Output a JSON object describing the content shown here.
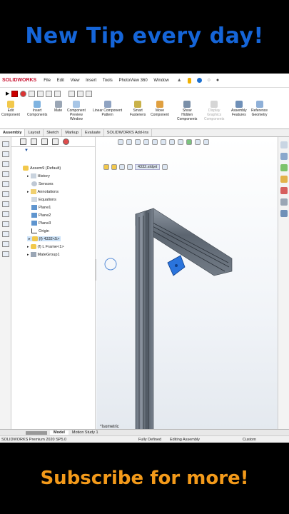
{
  "banner_top": "New Tip every day!",
  "banner_bottom": "Subscribe for more!",
  "app": {
    "logo": "SOLIDWORKS",
    "menu": [
      "File",
      "Edit",
      "View",
      "Insert",
      "Tools",
      "PhotoView 360",
      "Window"
    ],
    "commands": [
      {
        "label": "Edit\nComponent"
      },
      {
        "label": "Insert\nComponents"
      },
      {
        "label": "Mate"
      },
      {
        "label": "Component\nPreview\nWindow"
      },
      {
        "label": "Linear Component\nPattern"
      },
      {
        "label": "Smart\nFasteners"
      },
      {
        "label": "Move\nComponent"
      },
      {
        "label": "Show\nHidden\nComponents"
      },
      {
        "label": "Display\nGraphics\nComponents"
      },
      {
        "label": "Assembly\nFeatures"
      },
      {
        "label": "Reference\nGeometry"
      }
    ],
    "tabs": [
      "Assembly",
      "Layout",
      "Sketch",
      "Markup",
      "Evaluate",
      "SOLIDWORKS Add-Ins"
    ],
    "tree": {
      "root": "Assem9 (Default)",
      "items": [
        "History",
        "Sensors",
        "Annotations",
        "Equations",
        "Plane1",
        "Plane2",
        "Plane3",
        "Origin",
        "(f) 4332<5>",
        "(f) L Frame<1>",
        "MateGroup1"
      ]
    },
    "breadcrumb": "4332.sldprt",
    "view_label": "*Isometric",
    "bottom_tabs": [
      "Model",
      "Motion Study 1"
    ],
    "status": {
      "product": "SOLIDWORKS Premium 2020 SP5.0",
      "state": "Fully Defined",
      "mode": "Editing Assembly",
      "units": "Custom"
    }
  }
}
